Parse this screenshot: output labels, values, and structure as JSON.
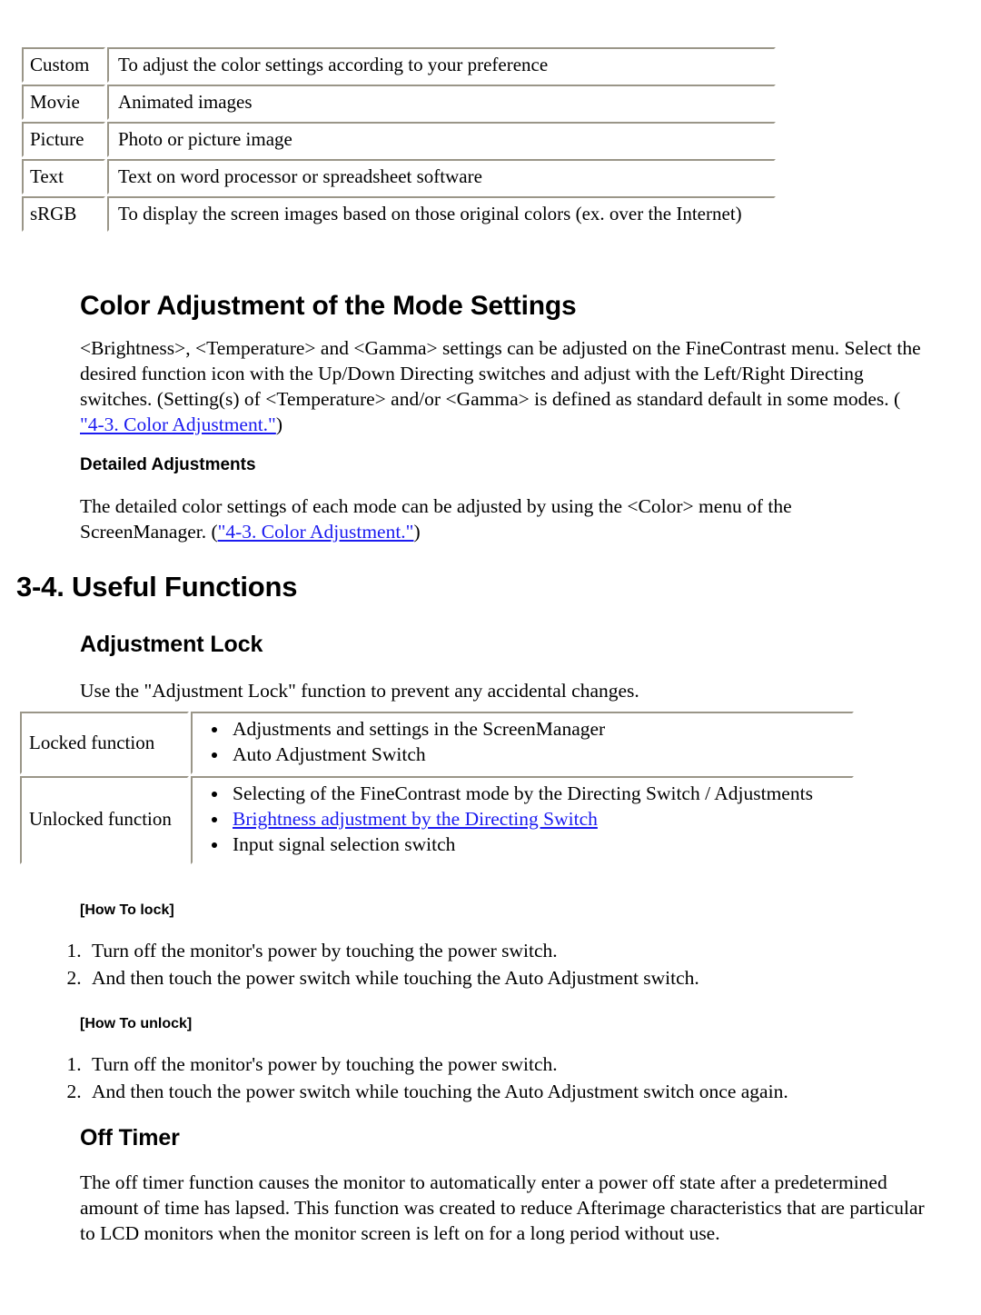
{
  "modes_table": {
    "rows": [
      {
        "name": "Custom",
        "desc": "To adjust the color settings according to your preference"
      },
      {
        "name": "Movie",
        "desc": "Animated images"
      },
      {
        "name": "Picture",
        "desc": "Photo or picture image"
      },
      {
        "name": "Text",
        "desc": "Text on word processor or spreadsheet software"
      },
      {
        "name": "sRGB",
        "desc": "To display the screen images based on those original colors (ex. over the Internet)"
      }
    ]
  },
  "color_adjustment": {
    "heading": "Color Adjustment of the Mode Settings",
    "paragraph_before_link": "<Brightness>, <Temperature> and <Gamma> settings can be adjusted on the FineContrast menu. Select the desired function icon with the Up/Down Directing switches and adjust with the Left/Right Directing switches. (Setting(s) of <Temperature> and/or <Gamma> is defined as standard default in some modes. ( ",
    "link_text": "\"4-3. Color Adjustment.\"",
    "paragraph_after_link": ")"
  },
  "detailed_adjustments": {
    "heading": "Detailed Adjustments",
    "text_before_link": "The detailed color settings of each mode can be adjusted by using the <Color> menu of the ScreenManager. (",
    "link_text": "\"4-3. Color Adjustment.\"",
    "text_after_link": ")"
  },
  "useful_functions": {
    "heading": "3-4. Useful Functions"
  },
  "adjustment_lock": {
    "heading": "Adjustment Lock",
    "intro": "Use the \"Adjustment Lock\" function to prevent any accidental changes.",
    "table": {
      "rows": [
        {
          "label": "Locked function",
          "items": [
            {
              "text": "Adjustments and settings in the ScreenManager",
              "link": false
            },
            {
              "text": "Auto Adjustment Switch",
              "link": false
            }
          ]
        },
        {
          "label": "Unlocked function",
          "items": [
            {
              "text": "Selecting of the FineContrast mode by the Directing Switch / Adjustments",
              "link": false
            },
            {
              "text": "Brightness adjustment by the Directing Switch",
              "link": true
            },
            {
              "text": "Input signal selection switch",
              "link": false
            }
          ]
        }
      ]
    }
  },
  "how_to_lock": {
    "heading": "[How To lock]",
    "steps": [
      "Turn off the monitor's power by touching the power switch.",
      "And then touch the power switch while touching the Auto Adjustment switch."
    ]
  },
  "how_to_unlock": {
    "heading": "[How To unlock]",
    "steps": [
      "Turn off the monitor's power by touching the power switch.",
      "And then touch the power switch while touching the Auto Adjustment switch once again."
    ]
  },
  "off_timer": {
    "heading": "Off Timer",
    "paragraph": "The off timer function causes the monitor to automatically enter a power off state after a predetermined amount of time has lapsed. This function was created to reduce Afterimage characteristics that are particular to LCD monitors when the monitor screen is left on for a long period without use."
  },
  "colors": {
    "link": "#1b1bf0",
    "text": "#000000",
    "table_border_shadow": "#9a9688",
    "background": "#ffffff"
  }
}
